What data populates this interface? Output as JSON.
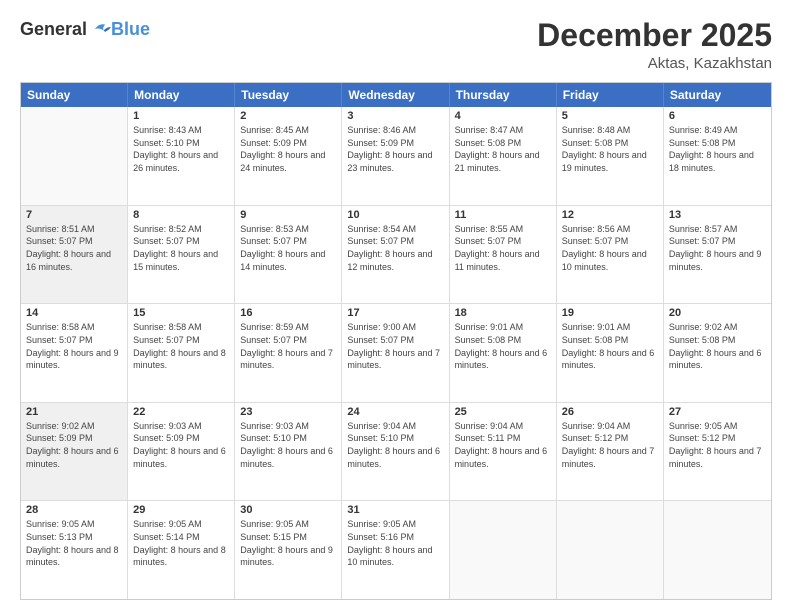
{
  "logo": {
    "general": "General",
    "blue": "Blue"
  },
  "title": "December 2025",
  "subtitle": "Aktas, Kazakhstan",
  "calendar": {
    "headers": [
      "Sunday",
      "Monday",
      "Tuesday",
      "Wednesday",
      "Thursday",
      "Friday",
      "Saturday"
    ],
    "rows": [
      [
        {
          "day": "",
          "empty": true
        },
        {
          "day": "1",
          "sunrise": "Sunrise: 8:43 AM",
          "sunset": "Sunset: 5:10 PM",
          "daylight": "Daylight: 8 hours and 26 minutes."
        },
        {
          "day": "2",
          "sunrise": "Sunrise: 8:45 AM",
          "sunset": "Sunset: 5:09 PM",
          "daylight": "Daylight: 8 hours and 24 minutes."
        },
        {
          "day": "3",
          "sunrise": "Sunrise: 8:46 AM",
          "sunset": "Sunset: 5:09 PM",
          "daylight": "Daylight: 8 hours and 23 minutes."
        },
        {
          "day": "4",
          "sunrise": "Sunrise: 8:47 AM",
          "sunset": "Sunset: 5:08 PM",
          "daylight": "Daylight: 8 hours and 21 minutes."
        },
        {
          "day": "5",
          "sunrise": "Sunrise: 8:48 AM",
          "sunset": "Sunset: 5:08 PM",
          "daylight": "Daylight: 8 hours and 19 minutes."
        },
        {
          "day": "6",
          "sunrise": "Sunrise: 8:49 AM",
          "sunset": "Sunset: 5:08 PM",
          "daylight": "Daylight: 8 hours and 18 minutes."
        }
      ],
      [
        {
          "day": "7",
          "sunrise": "Sunrise: 8:51 AM",
          "sunset": "Sunset: 5:07 PM",
          "daylight": "Daylight: 8 hours and 16 minutes.",
          "shaded": true
        },
        {
          "day": "8",
          "sunrise": "Sunrise: 8:52 AM",
          "sunset": "Sunset: 5:07 PM",
          "daylight": "Daylight: 8 hours and 15 minutes."
        },
        {
          "day": "9",
          "sunrise": "Sunrise: 8:53 AM",
          "sunset": "Sunset: 5:07 PM",
          "daylight": "Daylight: 8 hours and 14 minutes."
        },
        {
          "day": "10",
          "sunrise": "Sunrise: 8:54 AM",
          "sunset": "Sunset: 5:07 PM",
          "daylight": "Daylight: 8 hours and 12 minutes."
        },
        {
          "day": "11",
          "sunrise": "Sunrise: 8:55 AM",
          "sunset": "Sunset: 5:07 PM",
          "daylight": "Daylight: 8 hours and 11 minutes."
        },
        {
          "day": "12",
          "sunrise": "Sunrise: 8:56 AM",
          "sunset": "Sunset: 5:07 PM",
          "daylight": "Daylight: 8 hours and 10 minutes."
        },
        {
          "day": "13",
          "sunrise": "Sunrise: 8:57 AM",
          "sunset": "Sunset: 5:07 PM",
          "daylight": "Daylight: 8 hours and 9 minutes."
        }
      ],
      [
        {
          "day": "14",
          "sunrise": "Sunrise: 8:58 AM",
          "sunset": "Sunset: 5:07 PM",
          "daylight": "Daylight: 8 hours and 9 minutes."
        },
        {
          "day": "15",
          "sunrise": "Sunrise: 8:58 AM",
          "sunset": "Sunset: 5:07 PM",
          "daylight": "Daylight: 8 hours and 8 minutes."
        },
        {
          "day": "16",
          "sunrise": "Sunrise: 8:59 AM",
          "sunset": "Sunset: 5:07 PM",
          "daylight": "Daylight: 8 hours and 7 minutes."
        },
        {
          "day": "17",
          "sunrise": "Sunrise: 9:00 AM",
          "sunset": "Sunset: 5:07 PM",
          "daylight": "Daylight: 8 hours and 7 minutes."
        },
        {
          "day": "18",
          "sunrise": "Sunrise: 9:01 AM",
          "sunset": "Sunset: 5:08 PM",
          "daylight": "Daylight: 8 hours and 6 minutes."
        },
        {
          "day": "19",
          "sunrise": "Sunrise: 9:01 AM",
          "sunset": "Sunset: 5:08 PM",
          "daylight": "Daylight: 8 hours and 6 minutes."
        },
        {
          "day": "20",
          "sunrise": "Sunrise: 9:02 AM",
          "sunset": "Sunset: 5:08 PM",
          "daylight": "Daylight: 8 hours and 6 minutes."
        }
      ],
      [
        {
          "day": "21",
          "sunrise": "Sunrise: 9:02 AM",
          "sunset": "Sunset: 5:09 PM",
          "daylight": "Daylight: 8 hours and 6 minutes.",
          "shaded": true
        },
        {
          "day": "22",
          "sunrise": "Sunrise: 9:03 AM",
          "sunset": "Sunset: 5:09 PM",
          "daylight": "Daylight: 8 hours and 6 minutes."
        },
        {
          "day": "23",
          "sunrise": "Sunrise: 9:03 AM",
          "sunset": "Sunset: 5:10 PM",
          "daylight": "Daylight: 8 hours and 6 minutes."
        },
        {
          "day": "24",
          "sunrise": "Sunrise: 9:04 AM",
          "sunset": "Sunset: 5:10 PM",
          "daylight": "Daylight: 8 hours and 6 minutes."
        },
        {
          "day": "25",
          "sunrise": "Sunrise: 9:04 AM",
          "sunset": "Sunset: 5:11 PM",
          "daylight": "Daylight: 8 hours and 6 minutes."
        },
        {
          "day": "26",
          "sunrise": "Sunrise: 9:04 AM",
          "sunset": "Sunset: 5:12 PM",
          "daylight": "Daylight: 8 hours and 7 minutes."
        },
        {
          "day": "27",
          "sunrise": "Sunrise: 9:05 AM",
          "sunset": "Sunset: 5:12 PM",
          "daylight": "Daylight: 8 hours and 7 minutes."
        }
      ],
      [
        {
          "day": "28",
          "sunrise": "Sunrise: 9:05 AM",
          "sunset": "Sunset: 5:13 PM",
          "daylight": "Daylight: 8 hours and 8 minutes."
        },
        {
          "day": "29",
          "sunrise": "Sunrise: 9:05 AM",
          "sunset": "Sunset: 5:14 PM",
          "daylight": "Daylight: 8 hours and 8 minutes."
        },
        {
          "day": "30",
          "sunrise": "Sunrise: 9:05 AM",
          "sunset": "Sunset: 5:15 PM",
          "daylight": "Daylight: 8 hours and 9 minutes."
        },
        {
          "day": "31",
          "sunrise": "Sunrise: 9:05 AM",
          "sunset": "Sunset: 5:16 PM",
          "daylight": "Daylight: 8 hours and 10 minutes."
        },
        {
          "day": "",
          "empty": true
        },
        {
          "day": "",
          "empty": true
        },
        {
          "day": "",
          "empty": true
        }
      ]
    ]
  }
}
